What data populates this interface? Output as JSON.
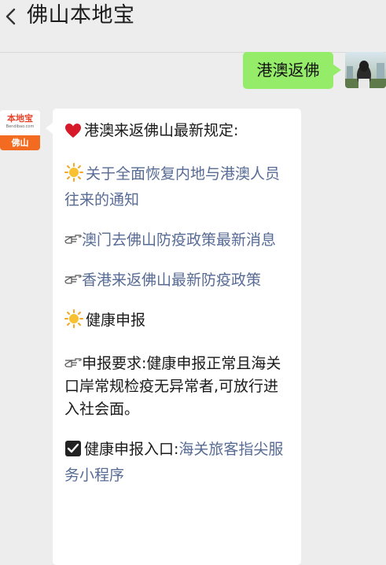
{
  "header": {
    "title": "佛山本地宝"
  },
  "conversation": {
    "user_message": "港澳返佛",
    "bot_avatar": {
      "brand": "本地宝",
      "url": "Bendibao.com",
      "city": "佛山"
    },
    "reply": {
      "heading": "港澳来返佛山最新规定:",
      "links": [
        "关于全面恢复内地与港澳人员往来的通知",
        "澳门去佛山防疫政策最新消息",
        "香港来返佛山最新防疫政策"
      ],
      "section_title": "健康申报",
      "requirement_prefix": "申报要求:",
      "requirement_text": "健康申报正常且海关口岸常规检疫无异常者,可放行进入社会面。",
      "entry_label": "健康申报入口:",
      "entry_link": "海关旅客指尖服务小程序"
    }
  }
}
